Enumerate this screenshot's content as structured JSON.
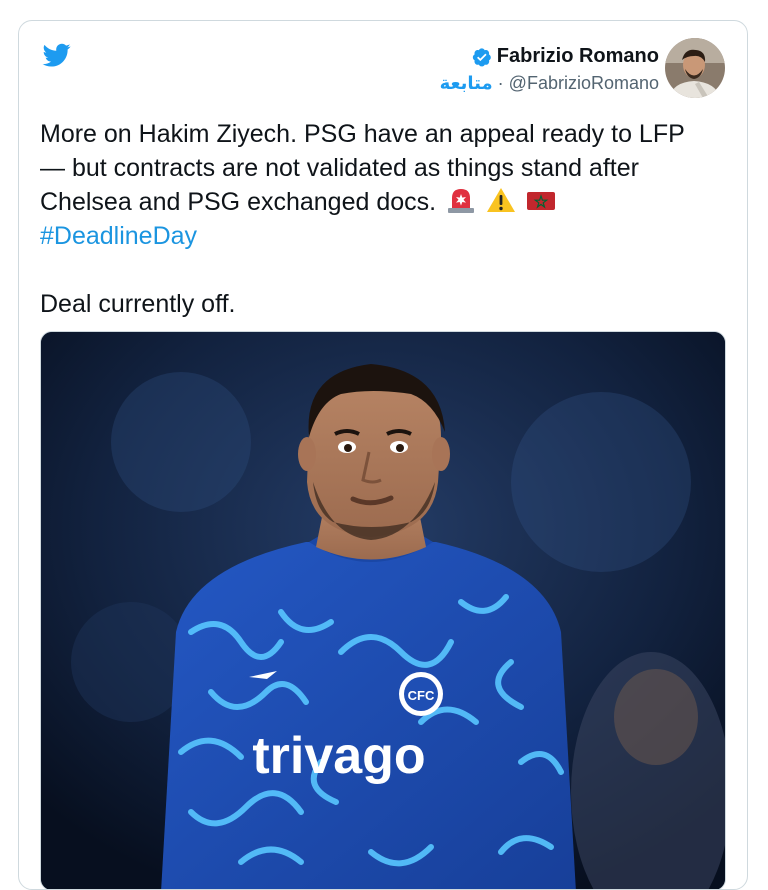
{
  "tweet": {
    "author": {
      "name": "Fabrizio Romano",
      "handle": "@FabrizioRomano",
      "separator": "·",
      "follow_label": "متابعة",
      "verified_icon": "verified-badge-icon",
      "avatar_icon": "profile-avatar"
    },
    "text_lines": [
      "More on Hakim Ziyech. PSG have an appeal ready to LFP",
      "— but contracts are not validated as things stand after",
      "Chelsea and PSG exchanged docs."
    ],
    "emojis": [
      "rotating-light-emoji",
      "warning-emoji",
      "morocco-flag-emoji"
    ],
    "hashtag": "#DeadlineDay",
    "second_paragraph": "Deal currently off.",
    "media": {
      "kind": "photo",
      "shirt_sponsor": "trivago"
    }
  },
  "colors": {
    "twitter_blue": "#1d9bf0",
    "hashtag_blue": "#1b95e0",
    "text": "#0f1419",
    "muted": "#536471",
    "border": "#cfd9de",
    "kit_blue": "#1f4fb4"
  },
  "icons": {
    "logo": "twitter-bird-icon"
  }
}
